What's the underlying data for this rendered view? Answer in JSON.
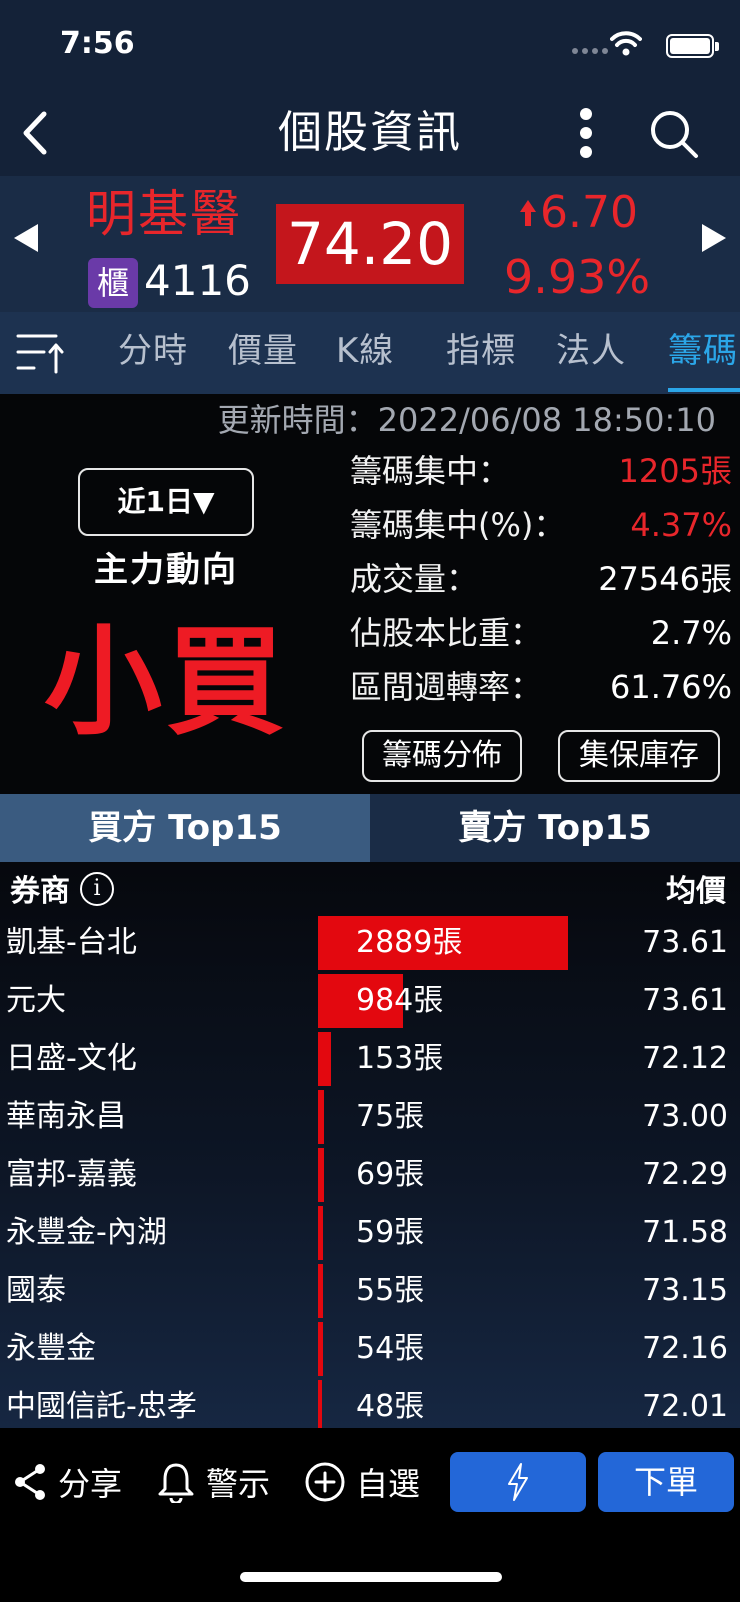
{
  "status_bar": {
    "time": "7:56"
  },
  "header": {
    "title": "個股資訊"
  },
  "quote": {
    "name": "明基醫",
    "market": "櫃",
    "code": "4116",
    "price": "74.20",
    "change": "6.70",
    "change_pct": "9.93%",
    "up_color": "#e8262b"
  },
  "tabs": [
    {
      "label": "分時"
    },
    {
      "label": "價量"
    },
    {
      "label": "K線"
    },
    {
      "label": "指標"
    },
    {
      "label": "法人"
    },
    {
      "label": "籌碼",
      "active": true
    }
  ],
  "summary": {
    "update_time": "更新時間：2022/06/08 18:50:10",
    "period": "近1日▼",
    "main_force_label": "主力動向",
    "main_force_value": "小買",
    "stats": [
      {
        "label": "籌碼集中：",
        "value": "1205張"
      },
      {
        "label": "籌碼集中(%)：",
        "value": "4.37%"
      },
      {
        "label": "成交量：",
        "value": "27546張"
      },
      {
        "label": "佔股本比重：",
        "value": "2.7%"
      },
      {
        "label": "區間週轉率：",
        "value": "61.76%"
      }
    ],
    "buttons": {
      "distribution": "籌碼分佈",
      "custody": "集保庫存"
    }
  },
  "side_tabs": {
    "buy": "買方 Top15",
    "sell": "賣方 Top15"
  },
  "broker_table": {
    "col_broker": "券商",
    "info_icon": "i",
    "col_avg": "均價",
    "rows": [
      {
        "broker": "凱基-台北",
        "volume": "2889張",
        "avg": "73.61",
        "lots": 2889
      },
      {
        "broker": "元大",
        "volume": "984張",
        "avg": "73.61",
        "lots": 984
      },
      {
        "broker": "日盛-文化",
        "volume": "153張",
        "avg": "72.12",
        "lots": 153
      },
      {
        "broker": "華南永昌",
        "volume": "75張",
        "avg": "73.00",
        "lots": 75
      },
      {
        "broker": "富邦-嘉義",
        "volume": "69張",
        "avg": "72.29",
        "lots": 69
      },
      {
        "broker": "永豐金-內湖",
        "volume": "59張",
        "avg": "71.58",
        "lots": 59
      },
      {
        "broker": "國泰",
        "volume": "55張",
        "avg": "73.15",
        "lots": 55
      },
      {
        "broker": "永豐金",
        "volume": "54張",
        "avg": "72.16",
        "lots": 54
      },
      {
        "broker": "中國信託-忠孝",
        "volume": "48張",
        "avg": "72.01",
        "lots": 48
      }
    ]
  },
  "toolbar": {
    "share": "分享",
    "alert": "警示",
    "watchlist": "自選",
    "order": "下單"
  }
}
